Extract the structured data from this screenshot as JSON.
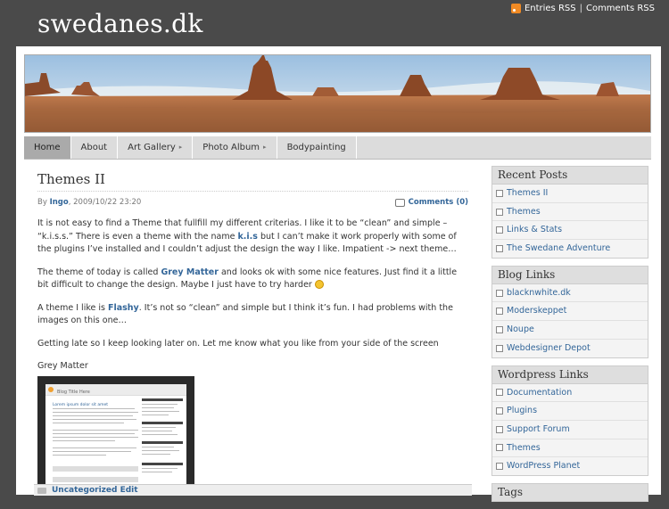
{
  "site": {
    "title": "swedanes.dk",
    "rss_entries": "Entries RSS",
    "rss_separator": "|",
    "rss_comments": "Comments RSS"
  },
  "nav": {
    "items": [
      {
        "label": "Home",
        "active": true,
        "has_submenu": false
      },
      {
        "label": "About",
        "active": false,
        "has_submenu": false
      },
      {
        "label": "Art Gallery",
        "active": false,
        "has_submenu": true
      },
      {
        "label": "Photo Album",
        "active": false,
        "has_submenu": true
      },
      {
        "label": "Bodypainting",
        "active": false,
        "has_submenu": false
      }
    ],
    "submenu_arrow": "▸"
  },
  "post": {
    "title": "Themes II",
    "by": "By",
    "author": "Ingo",
    "datetime": ", 2009/10/22 23:20",
    "comments": "Comments (0)",
    "p1_a": "It is not easy to find a Theme that fullfill my different criterias. I like it to be “clean” and simple – “k.i.s.s.” There is even a theme with the name ",
    "p1_link": "k.i.s",
    "p1_b": " but I can’t make it work properly with some of the plugins I’ve installed and I couldn’t adjust the design the way I like. Impatient -> next theme…",
    "p2_a": "The theme of today is called ",
    "p2_link": "Grey Matter",
    "p2_b": " and looks ok with some nice features. Just find it a little bit difficult to change the design. Maybe I just have to try harder ",
    "p3_a": "A theme I like is ",
    "p3_link": "Flashy",
    "p3_b": ". It’s not so “clean” and simple but I think it’s fun. I had problems with the images on this one…",
    "p4": "Getting late so I keep looking later on. Let me know what you like from your side of the screen",
    "caption": "Grey Matter",
    "thumb_title": "Blog Title Here",
    "thumb_sub": "Lorem ipsum dolor sit amet",
    "category_link": "Uncategorized Edit"
  },
  "sidebar": {
    "recent_posts": {
      "title": "Recent Posts",
      "items": [
        "Themes II",
        "Themes",
        "Links & Stats",
        "The Swedane Adventure"
      ]
    },
    "blog_links": {
      "title": "Blog Links",
      "items": [
        "blacknwhite.dk",
        "Moderskeppet",
        "Noupe",
        "Webdesigner Depot"
      ]
    },
    "wordpress_links": {
      "title": "Wordpress Links",
      "items": [
        "Documentation",
        "Plugins",
        "Support Forum",
        "Themes",
        "WordPress Planet"
      ]
    },
    "tags": {
      "title": "Tags"
    }
  },
  "colors": {
    "link": "#336699",
    "header_bg": "#4a4a4a",
    "nav_bg": "#dcdcdc",
    "nav_active": "#aaaaaa"
  }
}
